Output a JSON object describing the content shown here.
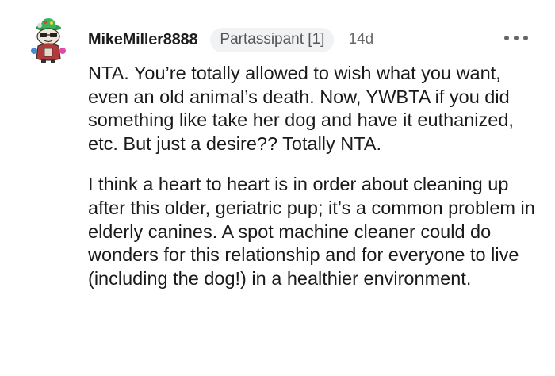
{
  "comment": {
    "author": "MikeMiller8888",
    "flair": "Partassipant [1]",
    "age": "14d",
    "avatar_icon": "snoo-avatar-icon",
    "more_icon": "more-options-icon",
    "paragraphs": [
      "NTA. You’re totally allowed to wish what you want, even an old animal’s death. Now, YWBTA if you did something like take her dog and have it euthanized, etc. But just a desire?? Totally NTA.",
      "I think a heart to heart is in order about cleaning up after this older, geriatric pup; it’s a common problem in elderly canines. A spot machine cleaner could do wonders for this relationship and for everyone to live (including the dog!) in a healthier environment."
    ]
  }
}
